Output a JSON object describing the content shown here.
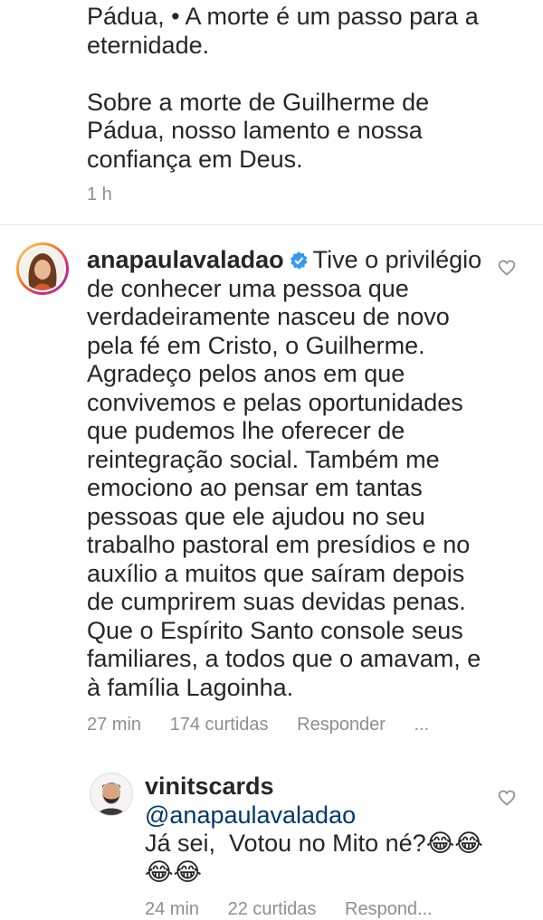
{
  "top_comment": {
    "text": "Pádua, • A morte é um passo para a\neternidade.\n\nSobre a morte de Guilherme de\nPádua, nosso lamento e nossa\nconfiança em Deus.",
    "time": "1 h"
  },
  "comment_main": {
    "username": "anapaulavaladao",
    "verified": true,
    "text_lines": [
      "Tive o privilégio",
      "de conhecer uma pessoa que",
      "verdadeiramente nasceu de novo",
      "pela fé em Cristo, o Guilherme.",
      "Agradeço pelos anos em que",
      "convivemos e pelas oportunidades",
      "que pudemos lhe oferecer de",
      "reintegração social. Também me",
      "emociono ao pensar em tantas",
      "pessoas que ele ajudou no seu",
      "trabalho pastoral em presídios e no",
      "auxílio a muitos que saíram depois",
      "de cumprirem suas devidas penas.",
      "Que o Espírito Santo console seus",
      "familiares, a todos que o amavam, e",
      "à família Lagoinha."
    ],
    "time": "27 min",
    "likes": "174 curtidas",
    "reply_label": "Responder",
    "more": "..."
  },
  "comment_reply": {
    "username": "vinitscards",
    "mention": "@anapaulavaladao",
    "text_line1": "Já sei,  Votou no Mito né?😂😂",
    "text_line2": "😂😂",
    "time": "24 min",
    "likes": "22 curtidas",
    "reply_label": "Respond..."
  },
  "icons": {
    "heart": "heart-outline-icon",
    "verified": "verified-badge-icon"
  },
  "colors": {
    "text": "#262626",
    "meta": "#8e8e8e",
    "verified": "#3897f0",
    "mention": "#00376b"
  }
}
